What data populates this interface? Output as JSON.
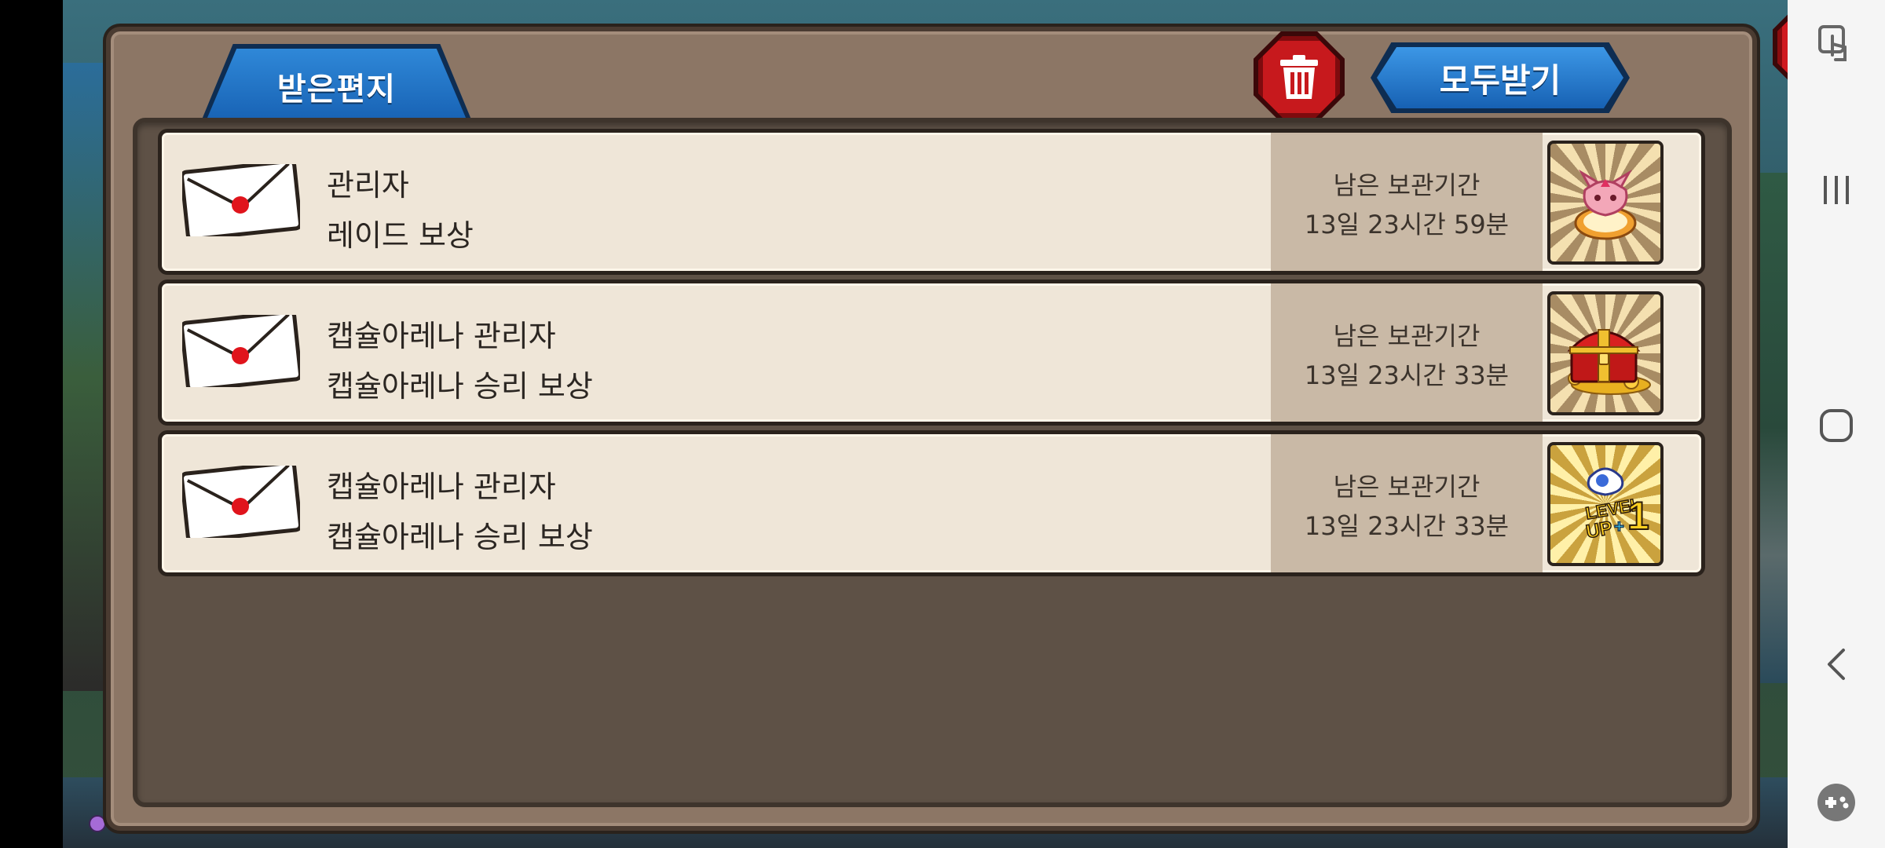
{
  "window": {
    "tab_label": "받은편지",
    "receive_all_label": "모두받기"
  },
  "mails": [
    {
      "sender": "관리자",
      "subject": "레이드 보상",
      "remaining_label": "남은 보관기간",
      "remaining_time": "13일 23시간 59분",
      "reward": "pet-egg-icon"
    },
    {
      "sender": "캡슐아레나 관리자",
      "subject": "캡슐아레나 승리 보상",
      "remaining_label": "남은 보관기간",
      "remaining_time": "13일 23시간 33분",
      "reward": "treasure-chest-icon"
    },
    {
      "sender": "캡슐아레나 관리자",
      "subject": "캡슐아레나 승리 보상",
      "remaining_label": "남은 보관기간",
      "remaining_time": "13일 23시간 33분",
      "reward": "level-up-icon"
    }
  ],
  "reward_badge": {
    "line1": "LEVEL",
    "line2": "UP",
    "plus": "+",
    "number": "1"
  },
  "colors": {
    "tab_blue": "#1761b3",
    "trash_red": "#c7191d",
    "row_bg": "#efe6d8",
    "panel_brown": "#8c7665"
  },
  "navbar": {
    "icons": [
      "touch-icon",
      "recent-apps-icon",
      "home-icon",
      "back-icon",
      "game-tools-icon"
    ]
  }
}
